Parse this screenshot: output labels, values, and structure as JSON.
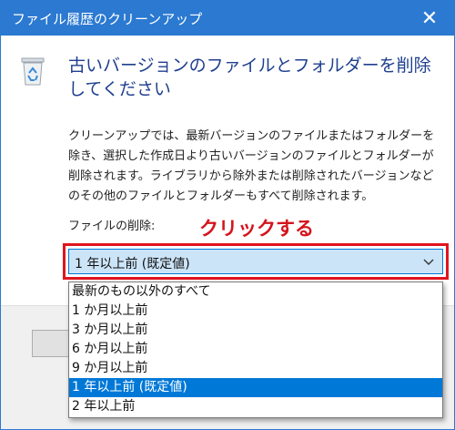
{
  "window": {
    "title": "ファイル履歴のクリーンアップ",
    "close_glyph": "✕",
    "accent": "#2b79d1"
  },
  "dialog": {
    "heading": "古いバージョンのファイルとフォルダーを削除してください",
    "description": "クリーンアップでは、最新バージョンのファイルまたはフォルダーを除き、選択した作成日より古いバージョンのファイルとフォルダーが削除されます。ライブラリから除外または削除されたバージョンなどのその他のファイルとフォルダーもすべて削除されます。",
    "field_label": "ファイルの削除:",
    "icon": "recycle-bin-icon"
  },
  "annotation": {
    "text": "クリックする",
    "color": "#d4141d"
  },
  "select": {
    "value": "1 年以上前 (既定値)",
    "options": [
      "最新のもの以外のすべて",
      "1 か月以上前",
      "3 か月以上前",
      "6 か月以上前",
      "9 か月以上前",
      "1 年以上前 (既定値)",
      "2 年以上前"
    ],
    "selected_index": 5,
    "selected_color": "#0078d7"
  }
}
